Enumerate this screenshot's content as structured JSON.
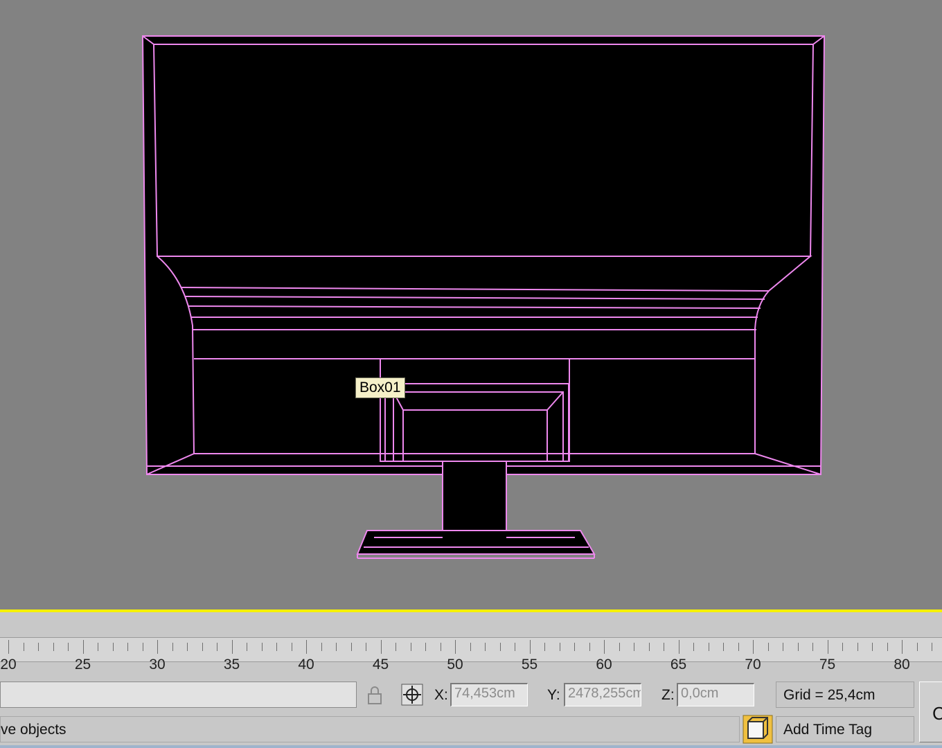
{
  "viewport": {
    "object_tooltip": "Box01",
    "wire_color": "#ee88ee",
    "background_color": "#828282"
  },
  "timeline": {
    "ruler_labels": [
      "20",
      "25",
      "30",
      "35",
      "40",
      "45",
      "50",
      "55",
      "60",
      "65",
      "70",
      "75",
      "80"
    ],
    "active_border_color": "#f5f000"
  },
  "status": {
    "x_label": "X:",
    "x_value": "74,453cm",
    "y_label": "Y:",
    "y_value": "2478,255cm",
    "z_label": "Z:",
    "z_value": "0,0cm",
    "grid_text": "Grid = 25,4cm",
    "prompt_text": "ve objects",
    "time_tag_label": "Add Time Tag"
  }
}
